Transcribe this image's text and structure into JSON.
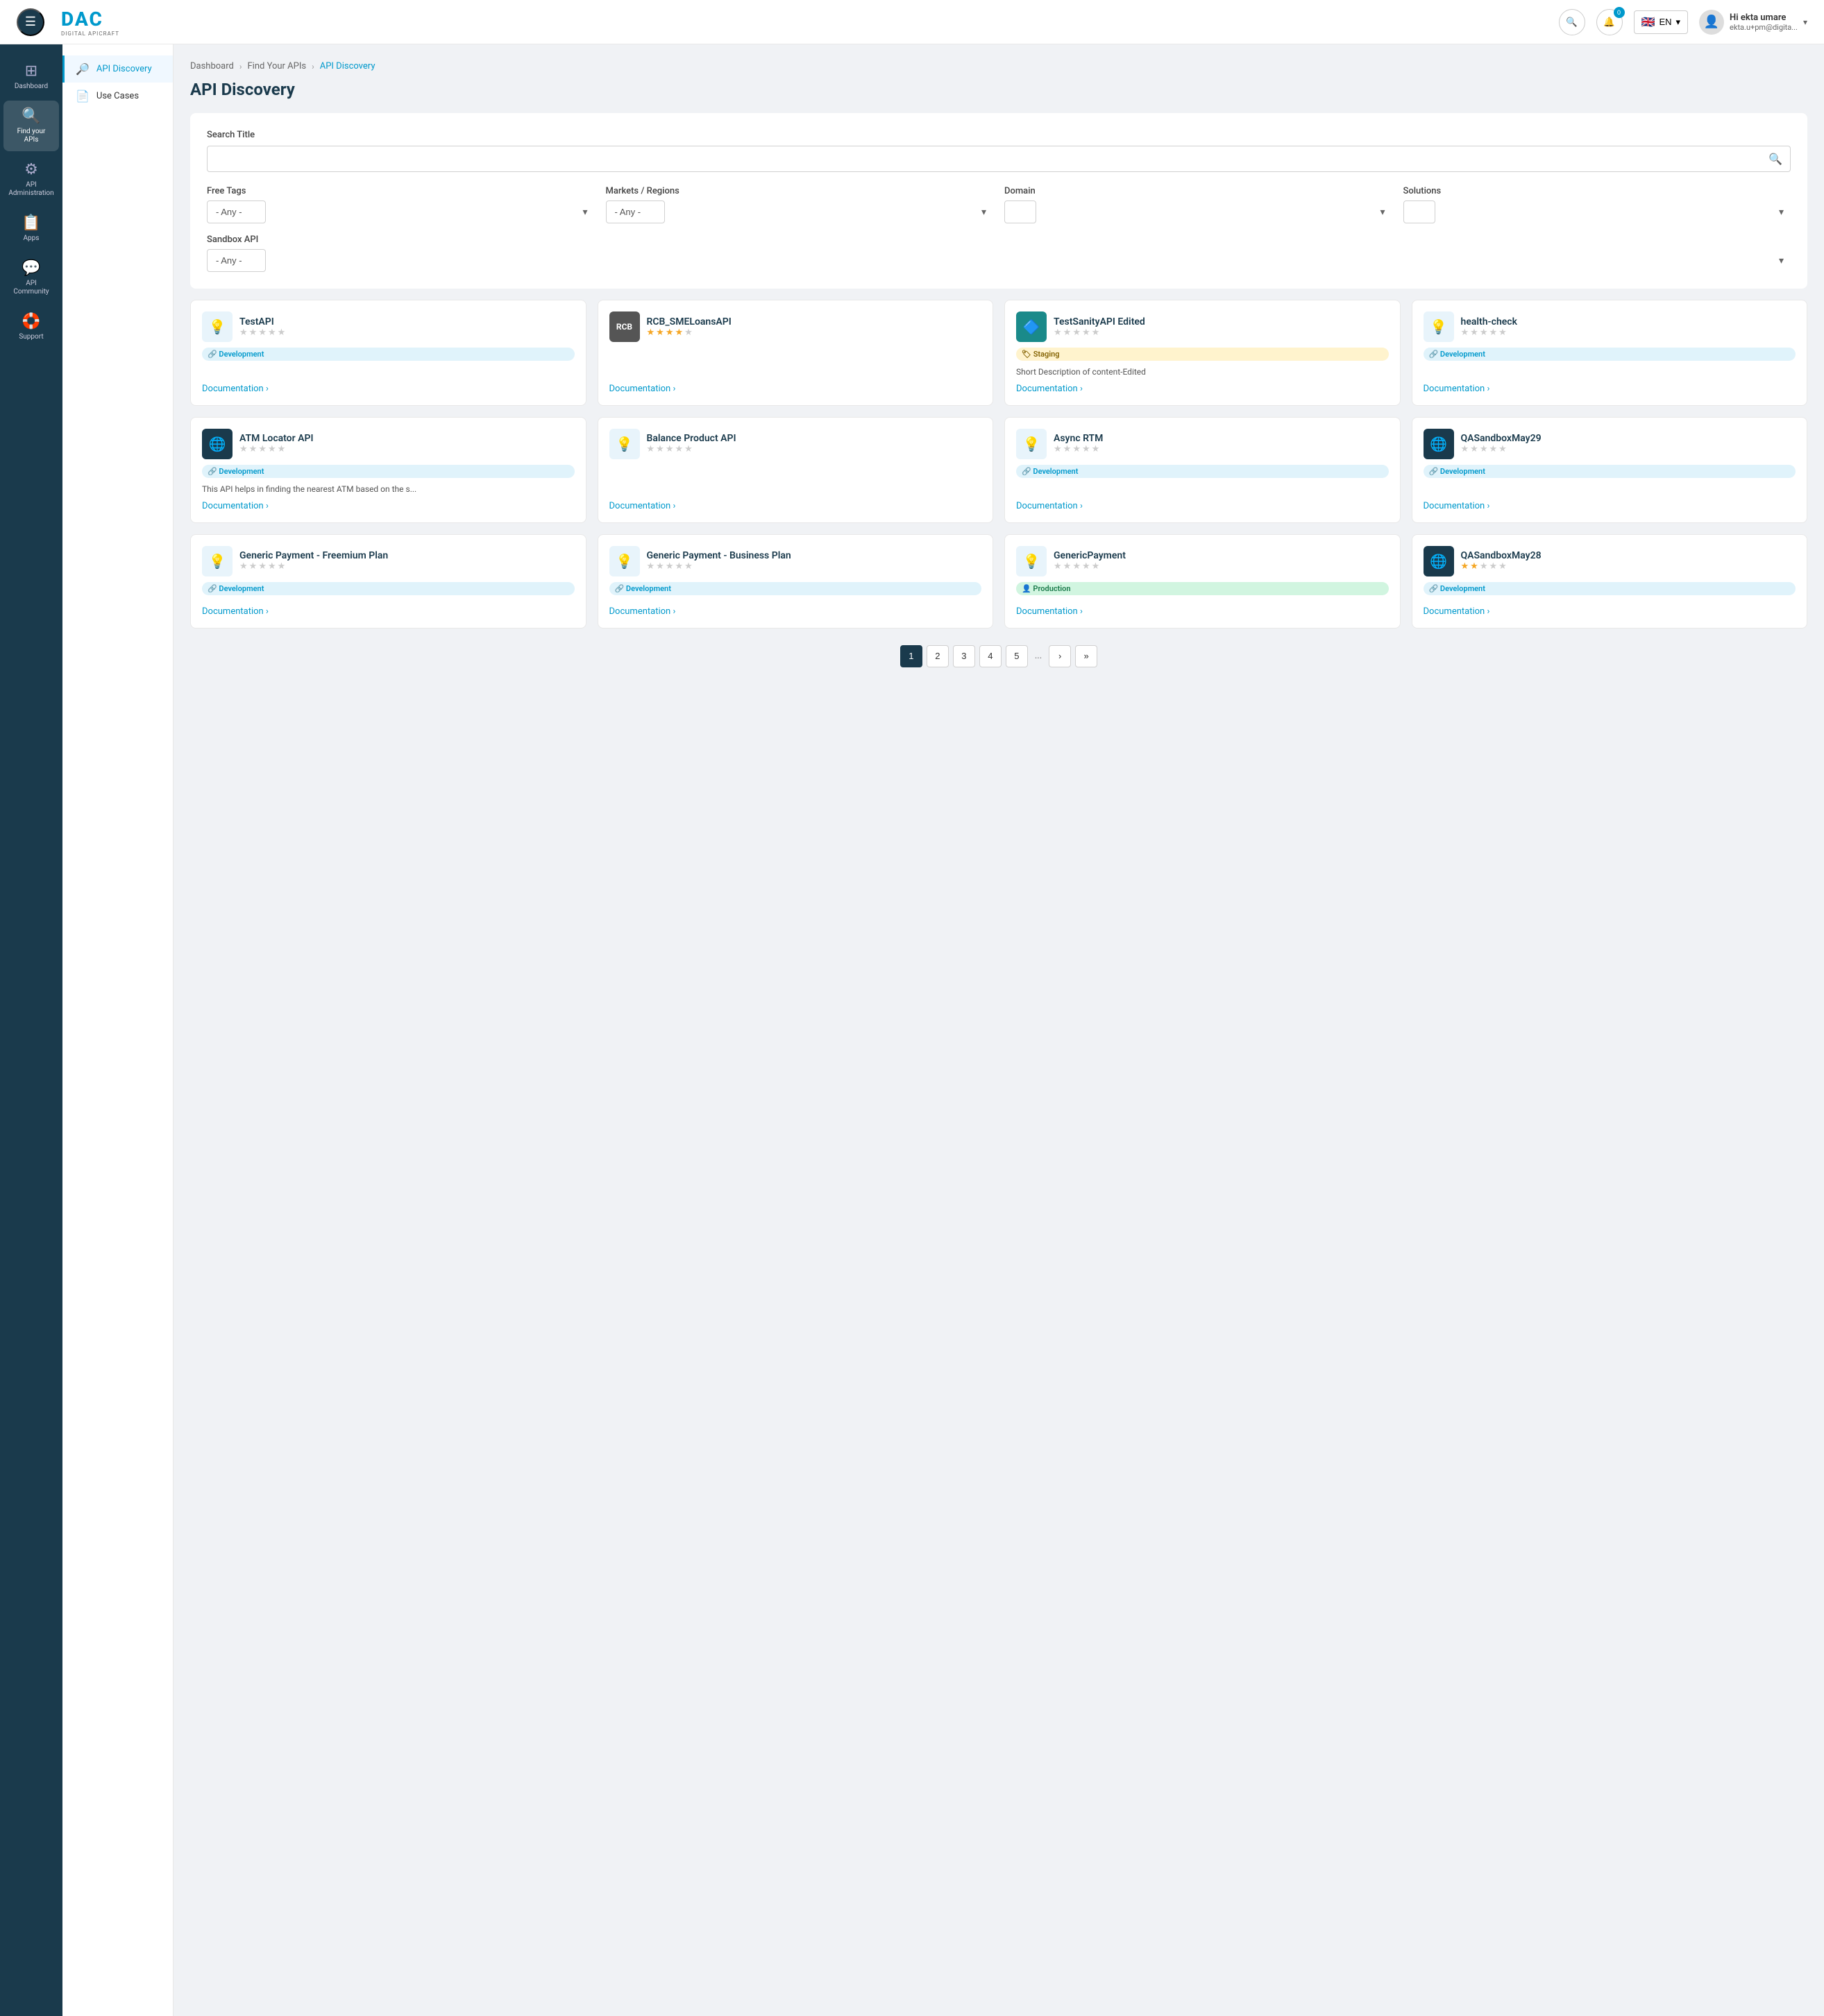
{
  "header": {
    "logo_dac": "DAC",
    "logo_sub": "DIGITAL APICRAFT",
    "search_btn_label": "Search",
    "notif_badge": "0",
    "lang": "EN",
    "flag_emoji": "🇬🇧",
    "user_name": "Hi ekta umare",
    "user_email": "ekta.u+pm@digita...",
    "chevron": "▾"
  },
  "sidebar": {
    "items": [
      {
        "id": "dashboard",
        "label": "Dashboard",
        "icon": "⊞"
      },
      {
        "id": "find-your-apis",
        "label": "Find your APIs",
        "icon": "🔍",
        "active": true
      },
      {
        "id": "api-administration",
        "label": "API Administration",
        "icon": "⚙"
      },
      {
        "id": "apps",
        "label": "Apps",
        "icon": "📋"
      },
      {
        "id": "api-community",
        "label": "API Community",
        "icon": "💬"
      },
      {
        "id": "support",
        "label": "Support",
        "icon": "🛟"
      }
    ]
  },
  "sub_sidebar": {
    "items": [
      {
        "id": "api-discovery",
        "label": "API Discovery",
        "icon": "🔎",
        "active": true
      },
      {
        "id": "use-cases",
        "label": "Use Cases",
        "icon": "📄"
      }
    ]
  },
  "breadcrumb": {
    "items": [
      {
        "label": "Dashboard",
        "active": false
      },
      {
        "label": "Find Your APIs",
        "active": false
      },
      {
        "label": "API Discovery",
        "active": true
      }
    ]
  },
  "page_title": "API Discovery",
  "search_section": {
    "search_title_label": "Search Title",
    "search_placeholder": "",
    "filters": [
      {
        "id": "free-tags",
        "label": "Free Tags",
        "default": "- Any -",
        "options": [
          "- Any -"
        ]
      },
      {
        "id": "markets-regions",
        "label": "Markets / Regions",
        "default": "- Any -",
        "options": [
          "- Any -"
        ]
      },
      {
        "id": "domain",
        "label": "Domain",
        "default": "",
        "options": [
          ""
        ]
      },
      {
        "id": "solutions",
        "label": "Solutions",
        "default": "",
        "options": [
          ""
        ]
      }
    ],
    "sandbox_label": "Sandbox API",
    "sandbox_options": [
      "- Any -"
    ]
  },
  "api_cards": [
    {
      "id": "testapi",
      "title": "TestAPI",
      "thumb_type": "icon",
      "thumb_icon": "💡",
      "thumb_bg": "light",
      "stars": [
        0,
        0,
        0,
        0,
        0
      ],
      "badges": [
        {
          "type": "development",
          "label": "Development",
          "icon": "🔗"
        }
      ],
      "description": "",
      "link_label": "Documentation",
      "link_icon": "›"
    },
    {
      "id": "rcb-sme-loans-api",
      "title": "RCB_SMELoansAPI",
      "thumb_type": "img",
      "thumb_icon": "🏦",
      "thumb_bg": "dark",
      "stars": [
        1,
        1,
        1,
        1,
        0
      ],
      "badges": [],
      "description": "",
      "link_label": "Documentation",
      "link_icon": "›"
    },
    {
      "id": "test-sanity-api-edited",
      "title": "TestSanityAPI Edited",
      "thumb_type": "img",
      "thumb_icon": "🟦",
      "thumb_bg": "teal",
      "stars": [
        0,
        0,
        0,
        0,
        0
      ],
      "badges": [
        {
          "type": "staging",
          "label": "Staging",
          "icon": "🏷"
        }
      ],
      "description": "Short Description of content-Edited",
      "link_label": "Documentation",
      "link_icon": "›"
    },
    {
      "id": "health-check",
      "title": "health-check",
      "thumb_type": "icon",
      "thumb_icon": "💡",
      "thumb_bg": "light",
      "stars": [
        0,
        0,
        0,
        0,
        0
      ],
      "badges": [
        {
          "type": "development",
          "label": "Development",
          "icon": "🔗"
        }
      ],
      "description": "",
      "link_label": "Documentation",
      "link_icon": "›"
    },
    {
      "id": "atm-locator-api",
      "title": "ATM Locator API",
      "thumb_type": "img",
      "thumb_icon": "🔵",
      "thumb_bg": "dark-blue",
      "stars": [
        0,
        0,
        0,
        0,
        0
      ],
      "badges": [
        {
          "type": "development",
          "label": "Development",
          "icon": "🔗"
        }
      ],
      "description": "This API helps in finding the nearest ATM based on the s...",
      "link_label": "Documentation",
      "link_icon": "›"
    },
    {
      "id": "balance-product-api",
      "title": "Balance Product API",
      "thumb_type": "icon",
      "thumb_icon": "💡",
      "thumb_bg": "light",
      "stars": [
        0,
        0,
        0,
        0,
        0
      ],
      "badges": [],
      "description": "",
      "link_label": "Documentation",
      "link_icon": "›"
    },
    {
      "id": "async-rtm",
      "title": "Async RTM",
      "thumb_type": "icon",
      "thumb_icon": "💡",
      "thumb_bg": "light",
      "stars": [
        0,
        0,
        0,
        0,
        0
      ],
      "badges": [
        {
          "type": "development",
          "label": "Development",
          "icon": "🔗"
        }
      ],
      "description": "",
      "link_label": "Documentation",
      "link_icon": "›"
    },
    {
      "id": "qasandboxmay29",
      "title": "QASandboxMay29",
      "thumb_type": "img",
      "thumb_icon": "🔵",
      "thumb_bg": "dark-blue",
      "stars": [
        0,
        0,
        0,
        0,
        0
      ],
      "badges": [
        {
          "type": "development",
          "label": "Development",
          "icon": "🔗"
        }
      ],
      "description": "",
      "link_label": "Documentation",
      "link_icon": "›"
    },
    {
      "id": "generic-payment-freemium",
      "title": "Generic Payment - Freemium Plan",
      "thumb_type": "icon",
      "thumb_icon": "💡",
      "thumb_bg": "light",
      "stars": [
        0,
        0,
        0,
        0,
        0
      ],
      "badges": [
        {
          "type": "development",
          "label": "Development",
          "icon": "🔗"
        }
      ],
      "description": "",
      "link_label": "Documentation",
      "link_icon": "›"
    },
    {
      "id": "generic-payment-business",
      "title": "Generic Payment - Business Plan",
      "thumb_type": "icon",
      "thumb_icon": "💡",
      "thumb_bg": "light",
      "stars": [
        0,
        0,
        0,
        0,
        0
      ],
      "badges": [
        {
          "type": "development",
          "label": "Development",
          "icon": "🔗"
        }
      ],
      "description": "",
      "link_label": "Documentation",
      "link_icon": "›"
    },
    {
      "id": "genericpayment",
      "title": "GenericPayment",
      "thumb_type": "icon",
      "thumb_icon": "💡",
      "thumb_bg": "light",
      "stars": [
        0,
        0,
        0,
        0,
        0
      ],
      "badges": [
        {
          "type": "production",
          "label": "Production",
          "icon": "👤"
        }
      ],
      "description": "",
      "link_label": "Documentation",
      "link_icon": "›"
    },
    {
      "id": "qasandboxmay28",
      "title": "QASandboxMay28",
      "thumb_type": "img",
      "thumb_icon": "🔵",
      "thumb_bg": "dark-blue",
      "stars": [
        1,
        1,
        0,
        0,
        0
      ],
      "badges": [
        {
          "type": "development",
          "label": "Development",
          "icon": "🔗"
        }
      ],
      "description": "",
      "link_label": "Documentation",
      "link_icon": "›"
    }
  ],
  "pagination": {
    "pages": [
      "1",
      "2",
      "3",
      "4",
      "5"
    ],
    "active": "1",
    "next_icon": "›",
    "last_icon": "»",
    "ellipsis": "..."
  }
}
